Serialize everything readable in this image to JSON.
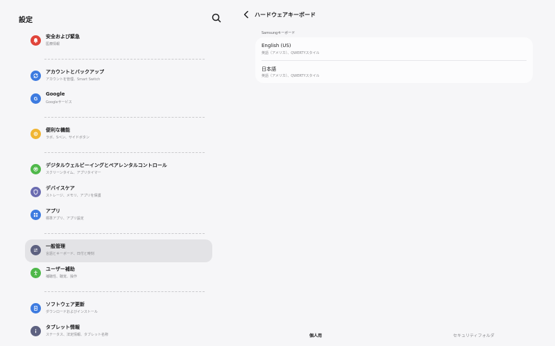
{
  "settings": {
    "title": "設定",
    "groups": [
      [
        {
          "id": "safety",
          "label": "安全および緊急",
          "sub": "医療情報",
          "icon": "bell-icon",
          "color": "#e0443a"
        }
      ],
      [
        {
          "id": "backup",
          "label": "アカウントとバックアップ",
          "sub": "アカウントを管理、Smart Switch",
          "icon": "sync-icon",
          "color": "#3d7be0"
        },
        {
          "id": "google",
          "label": "Google",
          "sub": "Googleサービス",
          "icon": "google-icon",
          "color": "#3d7be0"
        }
      ],
      [
        {
          "id": "advanced",
          "label": "便利な機能",
          "sub": "ラボ、Sペン、サイドボタン",
          "icon": "gear-plus-icon",
          "color": "#f0b533"
        }
      ],
      [
        {
          "id": "wellbeing",
          "label": "デジタルウェルビーイングとペアレンタルコントロール",
          "sub": "スクリーンタイム、アプリタイマー",
          "icon": "heart-icon",
          "color": "#4fb84a"
        },
        {
          "id": "devicecare",
          "label": "デバイスケア",
          "sub": "ストレージ、メモリ、アプリを保護",
          "icon": "shield-icon",
          "color": "#6a6bb0"
        },
        {
          "id": "apps",
          "label": "アプリ",
          "sub": "標準アプリ、アプリ設定",
          "icon": "grid-icon",
          "color": "#3d7be0"
        }
      ],
      [
        {
          "id": "general",
          "label": "一般管理",
          "sub": "言語とキーボード、日付と時刻",
          "icon": "sliders-icon",
          "color": "#5d6180",
          "selected": true
        },
        {
          "id": "accessibility",
          "label": "ユーザー補助",
          "sub": "補聴性、聴覚、操作",
          "icon": "accessibility-icon",
          "color": "#4fb84a"
        }
      ],
      [
        {
          "id": "update",
          "label": "ソフトウェア更新",
          "sub": "ダウンロードおよびインストール",
          "icon": "update-icon",
          "color": "#3d7be0"
        },
        {
          "id": "about",
          "label": "タブレット情報",
          "sub": "ステータス、法定情報、タブレット名称",
          "icon": "info-icon",
          "color": "#5d6180"
        }
      ]
    ]
  },
  "detail": {
    "title": "ハードウェアキーボード",
    "section_header": "Samsungキーボード",
    "keyboards": [
      {
        "label": "English (US)",
        "sub": "英語（アメリカ）、QWERTYスタイル"
      },
      {
        "label": "日本語",
        "sub": "英語（アメリカ）、QWERTYスタイル"
      }
    ]
  },
  "bottom_tabs": {
    "personal": "個人用",
    "secure": "セキュリティフォルダ"
  }
}
